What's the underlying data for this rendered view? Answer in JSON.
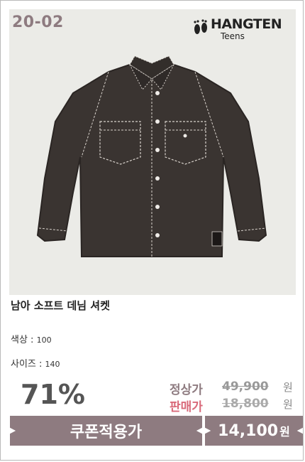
{
  "product": {
    "code": "20-02",
    "brand_name": "HANGTEN",
    "brand_sub": "Teens",
    "title": "남아 소프트 데님 셔켓",
    "color_label": "색상 : ",
    "color_value": "100",
    "size_label": "사이즈 : ",
    "size_value": "140"
  },
  "pricing": {
    "discount": "71%",
    "regular_label": "정상가",
    "regular_price": "49,900",
    "sale_label": "판매가",
    "sale_price": "18,800",
    "currency": "원",
    "coupon_label": "쿠폰적용가",
    "coupon_price": "14,100",
    "coupon_currency": "원"
  },
  "colors": {
    "accent": "#8e7b80",
    "sale": "#d96a7a",
    "photo_bg": "#ebebe7",
    "shirt": "#3a3431"
  }
}
